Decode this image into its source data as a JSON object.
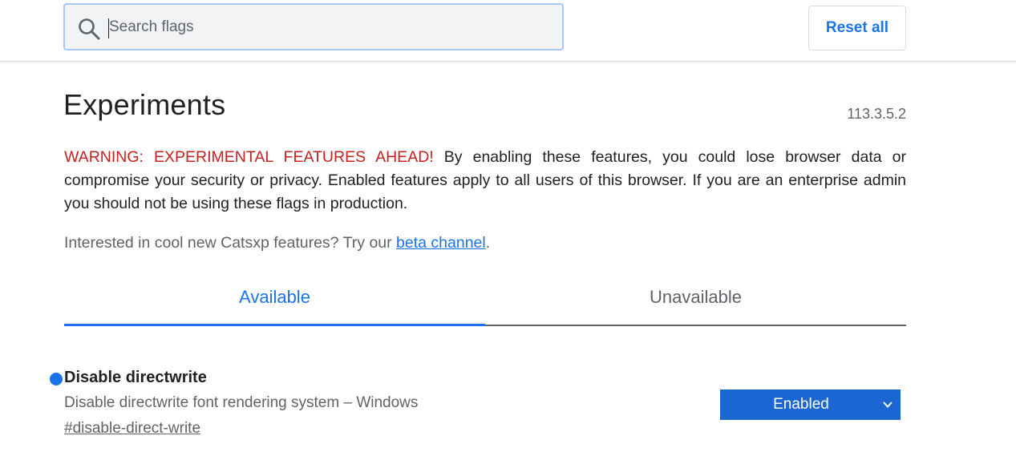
{
  "header": {
    "search": {
      "value": "",
      "placeholder": "Search flags"
    },
    "reset_label": "Reset all"
  },
  "page": {
    "title": "Experiments",
    "version": "113.3.5.2",
    "warning_label": "WARNING: EXPERIMENTAL FEATURES AHEAD!",
    "warning_text": " By enabling these features, you could lose browser data or compromise your security or privacy. Enabled features apply to all users of this browser. If you are an enterprise admin you should not be using these flags in production.",
    "promo_text": "Interested in cool new Catsxp features? Try our ",
    "promo_link": "beta channel",
    "promo_end": "."
  },
  "tabs": [
    {
      "label": "Available",
      "selected": true
    },
    {
      "label": "Unavailable",
      "selected": false
    }
  ],
  "flags": [
    {
      "name": "Disable directwrite",
      "description": "Disable directwrite font rendering system – Windows",
      "link": "#disable-direct-write",
      "state": "Enabled",
      "modified": true
    }
  ],
  "colors": {
    "accent": "#1a73e8",
    "warning": "#c5221f",
    "select_bg": "#1a66d2"
  },
  "icons": {
    "search": "search-icon",
    "dropdown": "chevron-down-icon",
    "modified": "modified-dot-icon"
  }
}
